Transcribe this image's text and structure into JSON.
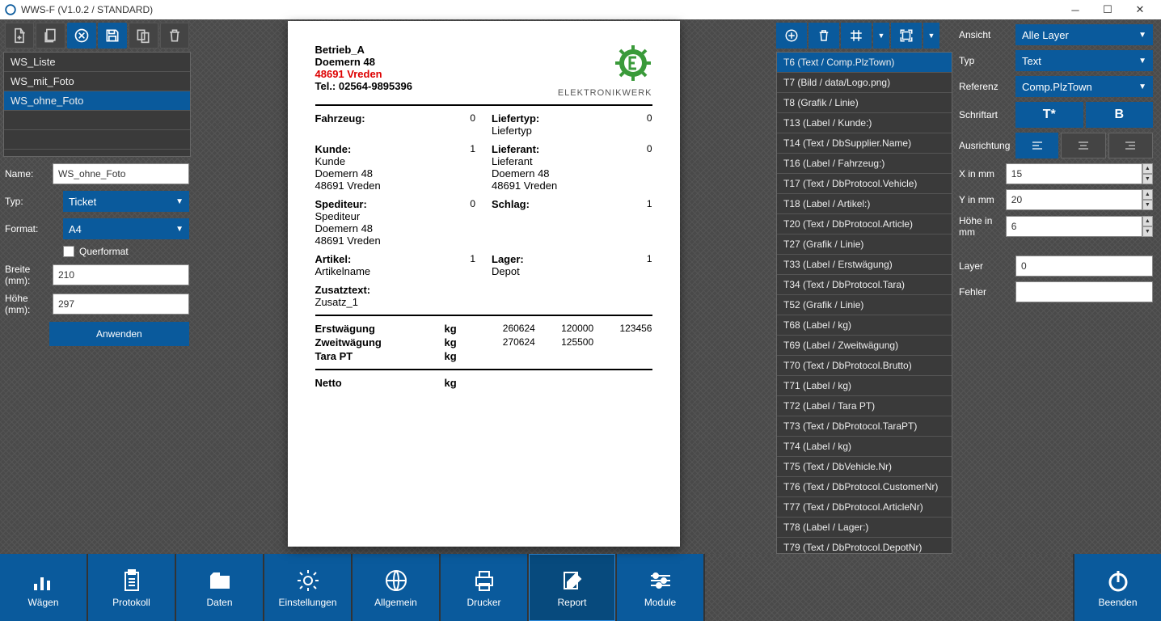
{
  "title": "WWS-F (V1.0.2 / STANDARD)",
  "leftList": [
    "WS_Liste",
    "WS_mit_Foto",
    "WS_ohne_Foto"
  ],
  "leftListSelected": 2,
  "form": {
    "nameLabel": "Name:",
    "name": "WS_ohne_Foto",
    "typLabel": "Typ:",
    "typ": "Ticket",
    "formatLabel": "Format:",
    "format": "A4",
    "querformat": "Querformat",
    "breiteLabel": "Breite (mm):",
    "breite": "210",
    "hoeheLabel": "Höhe (mm):",
    "hoehe": "297",
    "apply": "Anwenden"
  },
  "paper": {
    "company": "Betrieb_A",
    "street": "Doemern 48",
    "plztown": "48691 Vreden",
    "tel": "Tel.: 02564-9895396",
    "brand": "ELEKTRONIKWERK",
    "fahrzeugL": "Fahrzeug:",
    "fahrzeugN": "0",
    "liefertypL": "Liefertyp:",
    "liefertyp": "Liefertyp",
    "liefertypN": "0",
    "kundeL": "Kunde:",
    "kunde": "Kunde",
    "kundeAddr1": "Doemern 48",
    "kundeAddr2": "48691 Vreden",
    "kundeN": "1",
    "lieferantL": "Lieferant:",
    "lieferant": "Lieferant",
    "liefAddr1": "Doemern 48",
    "liefAddr2": "48691 Vreden",
    "lieferantN": "0",
    "spediteurL": "Spediteur:",
    "spediteur": "Spediteur",
    "spedAddr1": "Doemern 48",
    "spedAddr2": "48691 Vreden",
    "spediteurN": "0",
    "schlagL": "Schlag:",
    "schlagN": "1",
    "artikelL": "Artikel:",
    "artikel": "Artikelname",
    "artikelN": "1",
    "lagerL": "Lager:",
    "lager": "Depot",
    "lagerN": "1",
    "zusatzL": "Zusatztext:",
    "zusatz": "Zusatz_1",
    "erstL": "Erstwägung",
    "kg": "kg",
    "erstD": "260624",
    "erstT": "120000",
    "erstV": "123456",
    "zweitL": "Zweitwägung",
    "zweitD": "270624",
    "zweitT": "125500",
    "taraL": "Tara PT",
    "nettoL": "Netto"
  },
  "elements": [
    "T6 (Text / Comp.PlzTown)",
    "T7 (Bild / data/Logo.png)",
    "T8 (Grafik / Linie)",
    "T13 (Label / Kunde:)",
    "T14 (Text / DbSupplier.Name)",
    "T16 (Label / Fahrzeug:)",
    "T17 (Text / DbProtocol.Vehicle)",
    "T18 (Label / Artikel:)",
    "T20 (Text / DbProtocol.Article)",
    "T27 (Grafik / Linie)",
    "T33 (Label / Erstwägung)",
    "T34 (Text / DbProtocol.Tara)",
    "T52 (Grafik / Linie)",
    "T68 (Label / kg)",
    "T69 (Label / Zweitwägung)",
    "T70 (Text / DbProtocol.Brutto)",
    "T71 (Label / kg)",
    "T72 (Label / Tara PT)",
    "T73 (Text / DbProtocol.TaraPT)",
    "T74 (Label / kg)",
    "T75 (Text / DbVehicle.Nr)",
    "T76 (Text / DbProtocol.CustomerNr)",
    "T77 (Text / DbProtocol.ArticleNr)",
    "T78 (Label / Lager:)",
    "T79 (Text / DbProtocol.DepotNr)"
  ],
  "elementsSelected": 0,
  "props": {
    "ansichtL": "Ansicht",
    "ansicht": "Alle Layer",
    "typL": "Typ",
    "typ": "Text",
    "referenzL": "Referenz",
    "referenz": "Comp.PlzTown",
    "schriftL": "Schriftart",
    "tstar": "T*",
    "bold": "B",
    "ausrichtL": "Ausrichtung",
    "xL": "X in mm",
    "x": "15",
    "yL": "Y in mm",
    "y": "20",
    "hL": "Höhe in mm",
    "h": "6",
    "layerL": "Layer",
    "layer": "0",
    "fehlerL": "Fehler",
    "fehler": ""
  },
  "bottom": {
    "waegen": "Wägen",
    "protokoll": "Protokoll",
    "daten": "Daten",
    "einstellungen": "Einstellungen",
    "allgemein": "Allgemein",
    "drucker": "Drucker",
    "report": "Report",
    "module": "Module",
    "beenden": "Beenden"
  }
}
